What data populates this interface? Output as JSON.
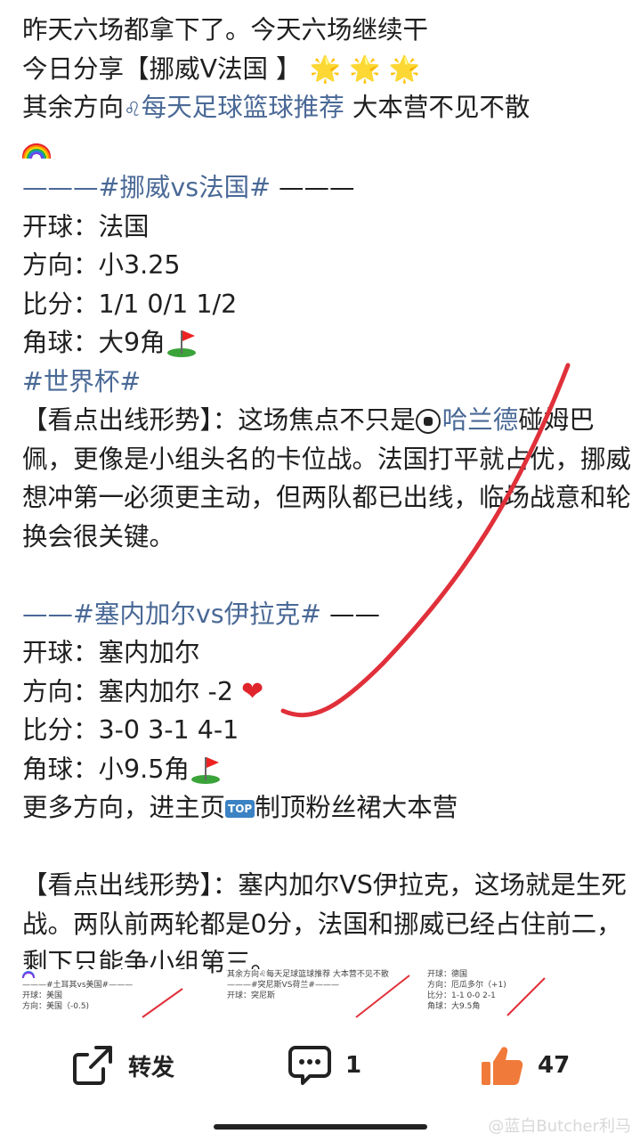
{
  "post": {
    "line1": "昨天六场都拿下了。今天六场继续干",
    "line2_prefix": "今日分享【挪威V法国 】",
    "line2_stars": "🌟 🌟 🌟",
    "line3_prefix": "其余方向",
    "line3_link": "每天足球篮球推荐",
    "line3_suffix": " 大本营不见不散",
    "match1_header_dash_left": "———",
    "match1_header_tag": "#挪威vs法国#",
    "match1_header_dash_right": " ———",
    "match1_kickoff": "开球：法国",
    "match1_direction": "方向：小3.25",
    "match1_score": "比分：1/1 0/1 1/2",
    "match1_corner": "角球：大9角",
    "tag_worldcup": "#世界杯#",
    "analysis1_label": "【看点出线形势】：这场焦点不只是",
    "analysis1_link": "哈兰德",
    "analysis1_rest": "碰姆巴佩，更像是小组头名的卡位战。法国打平就占优，挪威想冲第一必须更主动，但两队都已出线，临场战意和轮换会很关键。",
    "match2_header_dash_left": "——",
    "match2_header_tag": "#塞内加尔vs伊拉克#",
    "match2_header_dash_right": " ——",
    "match2_kickoff": "开球：塞内加尔",
    "match2_direction": "方向：塞内加尔 -2",
    "match2_score": "比分：3-0 3-1  4-1",
    "match2_corner": "角球：小9.5角",
    "more_prefix": "更多方向，进主页",
    "top_badge": "TOP",
    "more_suffix": "制顶粉丝裙大本营",
    "analysis2": "【看点出线形势】：塞内加尔VS伊拉克，这场就是生死战。两队前两轮都是0分，法国和挪威已经占住前二，剩下只能争小组第三。"
  },
  "thumbnails": [
    {
      "line1": "———#土耳其vs美国#———",
      "line2": "开球：美国",
      "line3": "方向：美国（-0.5)"
    },
    {
      "line1": "其余方向♌每天足球篮球推荐 大本营不见不散",
      "line2": "———#突尼斯VS荷兰#———",
      "line3": "开球：突尼斯"
    },
    {
      "line1": "开球：德国",
      "line2": "方向：厄瓜多尔（+1)",
      "line3": "比分：1-1 0-0 2-1",
      "line4": "角球：大9.5角"
    }
  ],
  "actions": {
    "repost_label": "转发",
    "comment_count": "1",
    "like_count": "47"
  },
  "watermark": "@蓝白Butcher利马",
  "colors": {
    "link_blue": "#4a6996",
    "text": "#1f1f1f",
    "like_orange": "#f07a3a",
    "annotation_red": "#e0303a"
  }
}
